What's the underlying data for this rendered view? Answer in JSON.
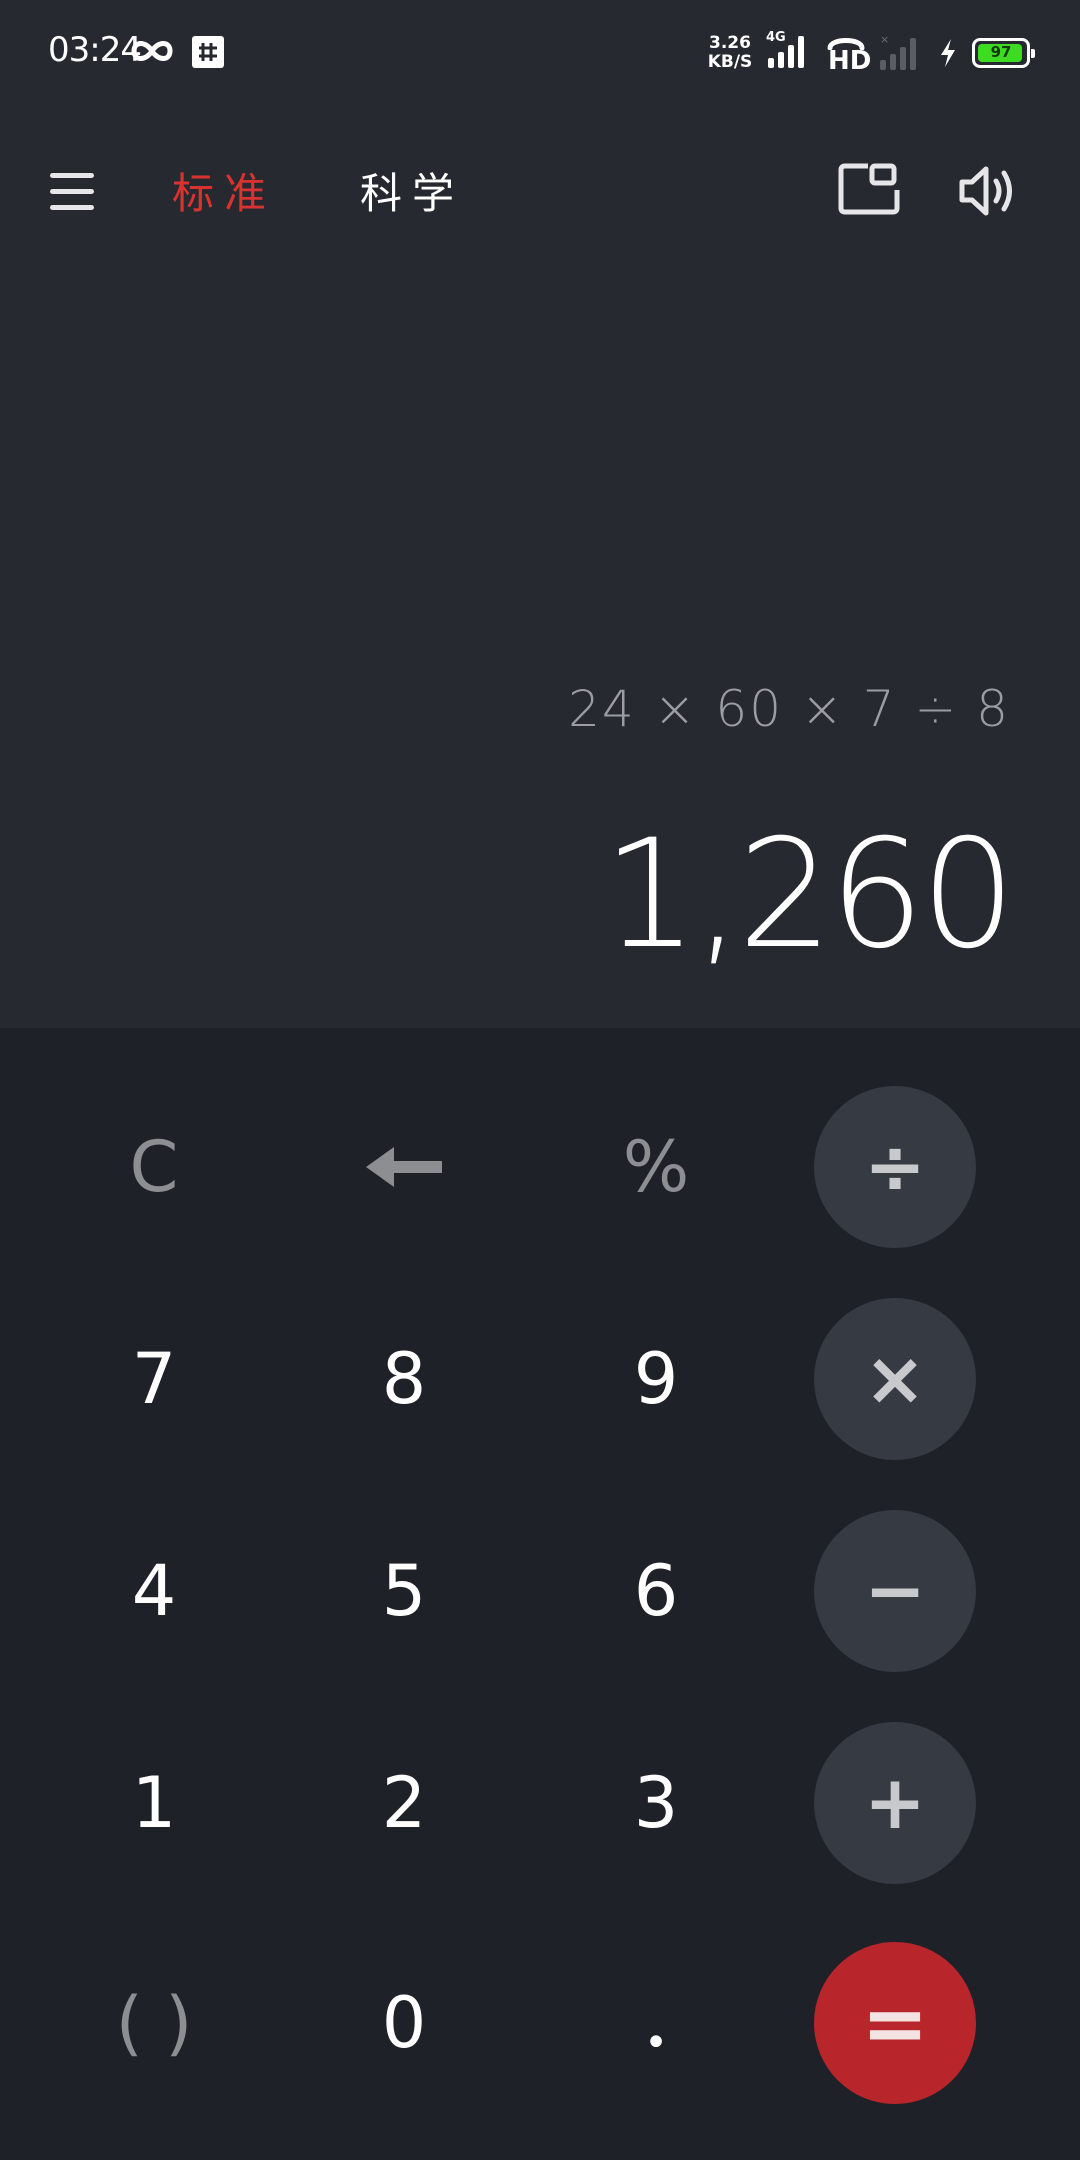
{
  "status_bar": {
    "time": "03:24",
    "net_speed_value": "3.26",
    "net_speed_unit": "KB/S",
    "network_type": "4G",
    "hd_label": "HD",
    "battery_level": "97",
    "battery_fraction": 0.97,
    "battery_color": "#3ddc23"
  },
  "toolbar": {
    "tab_standard": "标准",
    "tab_scientific": "科学",
    "active_tab_color": "#d8332f"
  },
  "display": {
    "expression": "24 × 60 × 7 ÷ 8",
    "result": "1,260"
  },
  "keypad": {
    "clear": "C",
    "backspace": "←",
    "percent": "%",
    "divide": "÷",
    "seven": "7",
    "eight": "8",
    "nine": "9",
    "multiply": "×",
    "four": "4",
    "five": "5",
    "six": "6",
    "minus": "−",
    "one": "1",
    "two": "2",
    "three": "3",
    "plus": "+",
    "parentheses": "( )",
    "zero": "0",
    "decimal": "•",
    "equals": "="
  },
  "icons": {
    "menu": "hamburger-menu-icon",
    "float": "floating-window-icon",
    "sound": "speaker-icon"
  }
}
